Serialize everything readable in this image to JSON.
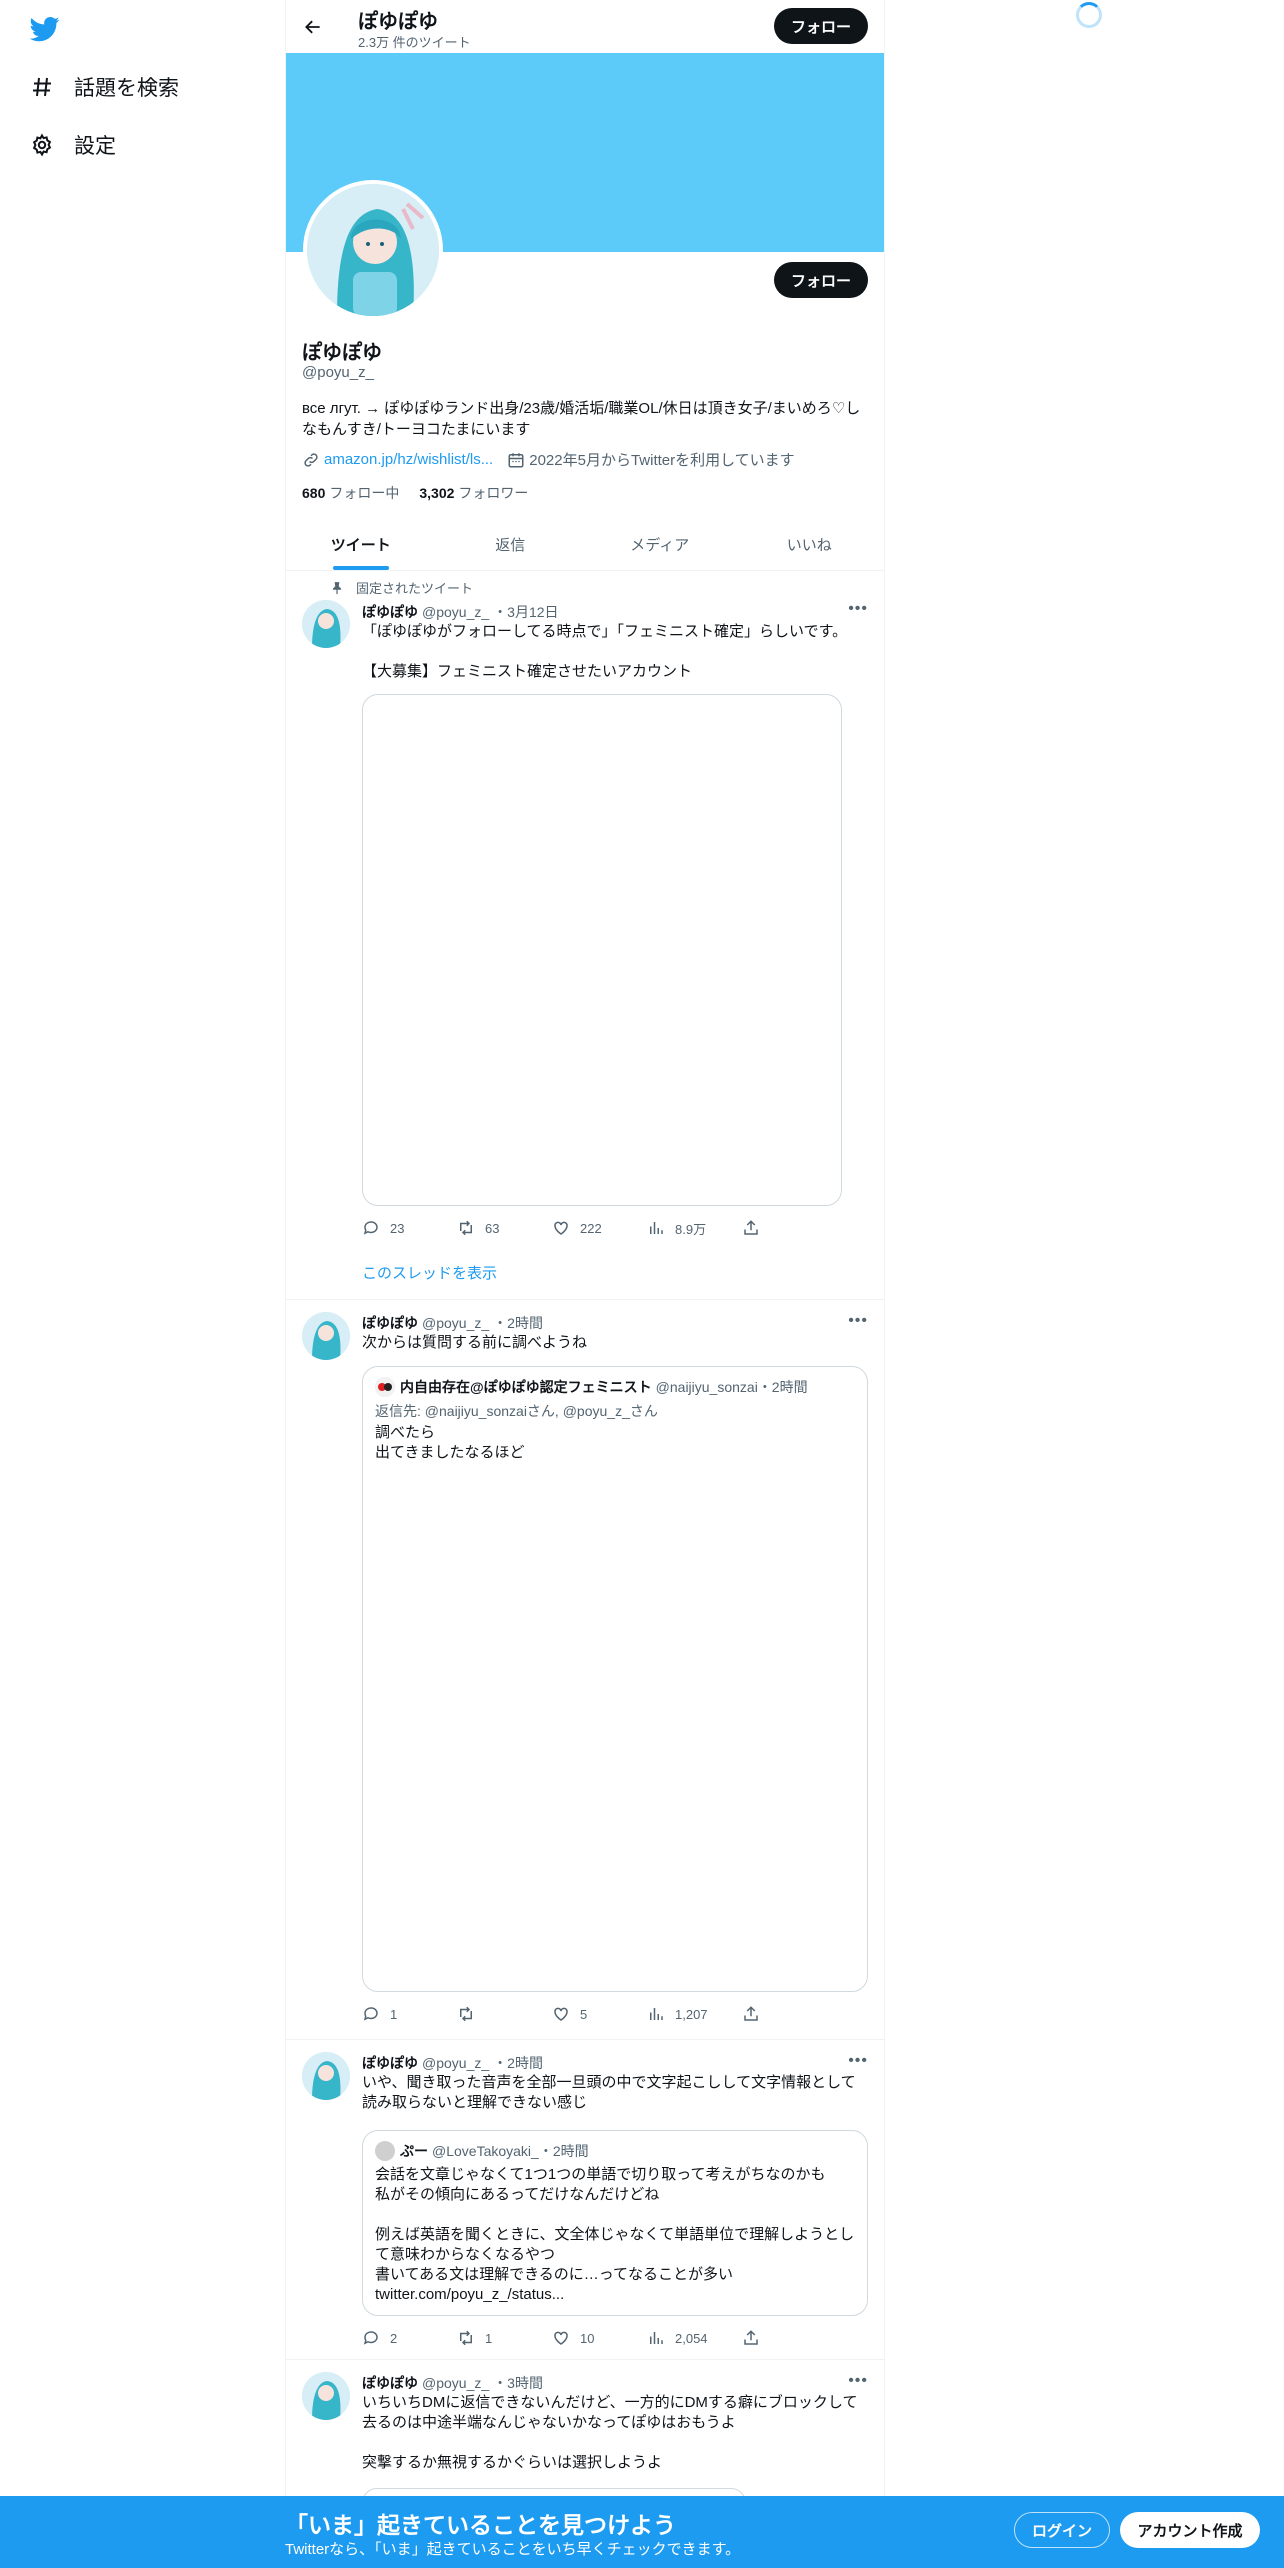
{
  "sidebar": {
    "items": [
      {
        "label": "話題を検索",
        "icon": "hashtag-icon"
      },
      {
        "label": "設定",
        "icon": "gear-icon"
      }
    ]
  },
  "header": {
    "name": "ぽゆぽゆ",
    "tweet_count": "2.3万 件のツイート",
    "follow_label": "フォロー"
  },
  "profile": {
    "name": "ぽゆぽゆ",
    "handle": "@poyu_z_",
    "bio": "все лгут. → ぽゆぽゆランド出身/23歳/婚活垢/職業OL/休日は頂き女子/まいめろ♡しなもんすき/トーヨコたまにいます",
    "link": "amazon.jp/hz/wishlist/ls...",
    "joined": "2022年5月からTwitterを利用しています",
    "following_count": "680",
    "following_label": "フォロー中",
    "followers_count": "3,302",
    "followers_label": "フォロワー",
    "follow_label": "フォロー"
  },
  "tabs": [
    {
      "label": "ツイート",
      "active": true
    },
    {
      "label": "返信",
      "active": false
    },
    {
      "label": "メディア",
      "active": false
    },
    {
      "label": "いいね",
      "active": false
    }
  ],
  "tweets": [
    {
      "pinned_label": "固定されたツイート",
      "name": "ぽゆぽゆ",
      "handle": "@poyu_z_",
      "time": "・3月12日",
      "text": "「ぽゆぽゆがフォローしてる時点で」「フェミニスト確定」らしいです。\n\n【大募集】フェミニスト確定させたいアカウント",
      "replies": "23",
      "retweets": "63",
      "likes": "222",
      "views": "8.9万",
      "thread_link": "このスレッドを表示"
    },
    {
      "name": "ぽゆぽゆ",
      "handle": "@poyu_z_",
      "time": "・2時間",
      "text": "次からは質問する前に調べようね",
      "quote": {
        "name": "内自由存在@ぽゆぽゆ認定フェミニスト",
        "handle": "@naijiyu_sonzai",
        "time": "・2時間",
        "reply_to": "返信先: @naijiyu_sonzaiさん, @poyu_z_さん",
        "text": "調べたら\n出てきましたなるほど"
      },
      "replies": "1",
      "retweets": "",
      "likes": "5",
      "views": "1,207"
    },
    {
      "name": "ぽゆぽゆ",
      "handle": "@poyu_z_",
      "time": "・2時間",
      "text": "いや、聞き取った音声を全部一旦頭の中で文字起こしして文字情報として読み取らないと理解できない感じ",
      "quote": {
        "name": "ぷー",
        "handle": "@LoveTakoyaki_",
        "time": "・2時間",
        "text": "会話を文章じゃなくて1つ1つの単語で切り取って考えがちなのかも\n私がその傾向にあるってだけなんだけどね\n\n例えば英語を聞くときに、文全体じゃなくて単語単位で理解しようとして意味わからなくなるやつ\n書いてある文は理解できるのに…ってなることが多い\ntwitter.com/poyu_z_/status..."
      },
      "replies": "2",
      "retweets": "1",
      "likes": "10",
      "views": "2,054"
    },
    {
      "name": "ぽゆぽゆ",
      "handle": "@poyu_z_",
      "time": "・3時間",
      "text": "いちいちDMに返信できないんだけど、一方的にDMする癖にブロックして去るのは中途半端なんじゃないかなってぽゆはおもうよ\n\n突撃するか無視するかぐらいは選択しようよ"
    }
  ],
  "bottom_bar": {
    "title": "「いま」起きていることを見つけよう",
    "subtitle": "Twitterなら、「いま」起きていることをいち早くチェックできます。",
    "login_label": "ログイン",
    "signup_label": "アカウント作成"
  },
  "colors": {
    "accent": "#1d9bf0",
    "banner": "#5ccbf9",
    "text": "#0f1419",
    "muted": "#536471"
  }
}
